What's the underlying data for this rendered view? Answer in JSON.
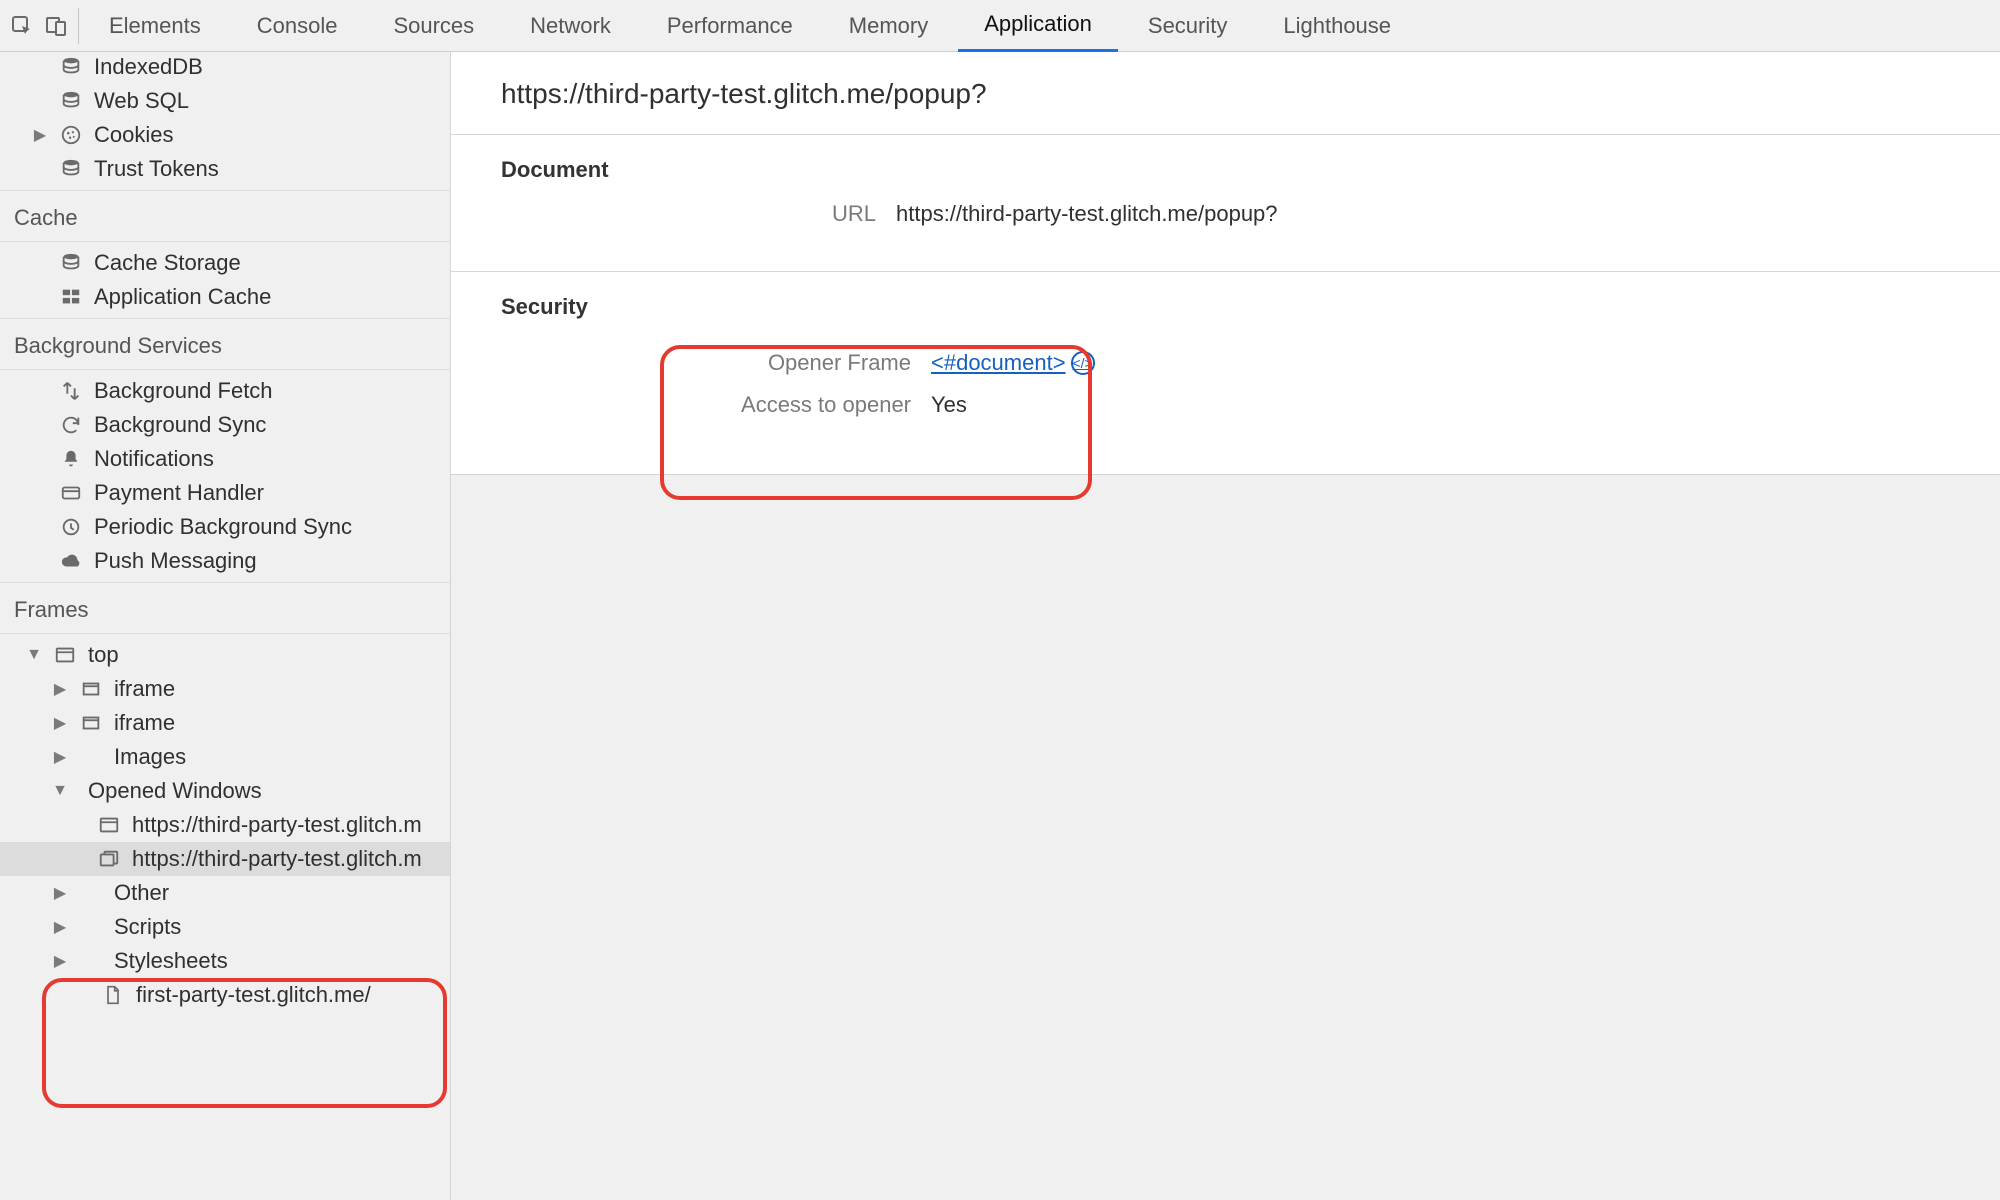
{
  "tabs": {
    "elements": "Elements",
    "console": "Console",
    "sources": "Sources",
    "network": "Network",
    "performance": "Performance",
    "memory": "Memory",
    "application": "Application",
    "security": "Security",
    "lighthouse": "Lighthouse"
  },
  "sidebar": {
    "storage": {
      "indexeddb": "IndexedDB",
      "websql": "Web SQL",
      "cookies": "Cookies",
      "trusttokens": "Trust Tokens"
    },
    "cache": {
      "header": "Cache",
      "cachestorage": "Cache Storage",
      "appcache": "Application Cache"
    },
    "bg": {
      "header": "Background Services",
      "fetch": "Background Fetch",
      "sync": "Background Sync",
      "notif": "Notifications",
      "payment": "Payment Handler",
      "periodic": "Periodic Background Sync",
      "push": "Push Messaging"
    },
    "frames": {
      "header": "Frames",
      "top": "top",
      "iframe": "iframe",
      "images": "Images",
      "opened": "Opened Windows",
      "ow1": "https://third-party-test.glitch.me/",
      "ow2": "https://third-party-test.glitch.me/",
      "other": "Other",
      "scripts": "Scripts",
      "stylesheets": "Stylesheets",
      "file": "first-party-test.glitch.me/"
    }
  },
  "main": {
    "title": "https://third-party-test.glitch.me/popup?",
    "doc": {
      "header": "Document",
      "url_label": "URL",
      "url": "https://third-party-test.glitch.me/popup?"
    },
    "sec": {
      "header": "Security",
      "opener_label": "Opener Frame",
      "opener_value": "<#document>",
      "access_label": "Access to opener",
      "access_value": "Yes"
    }
  }
}
